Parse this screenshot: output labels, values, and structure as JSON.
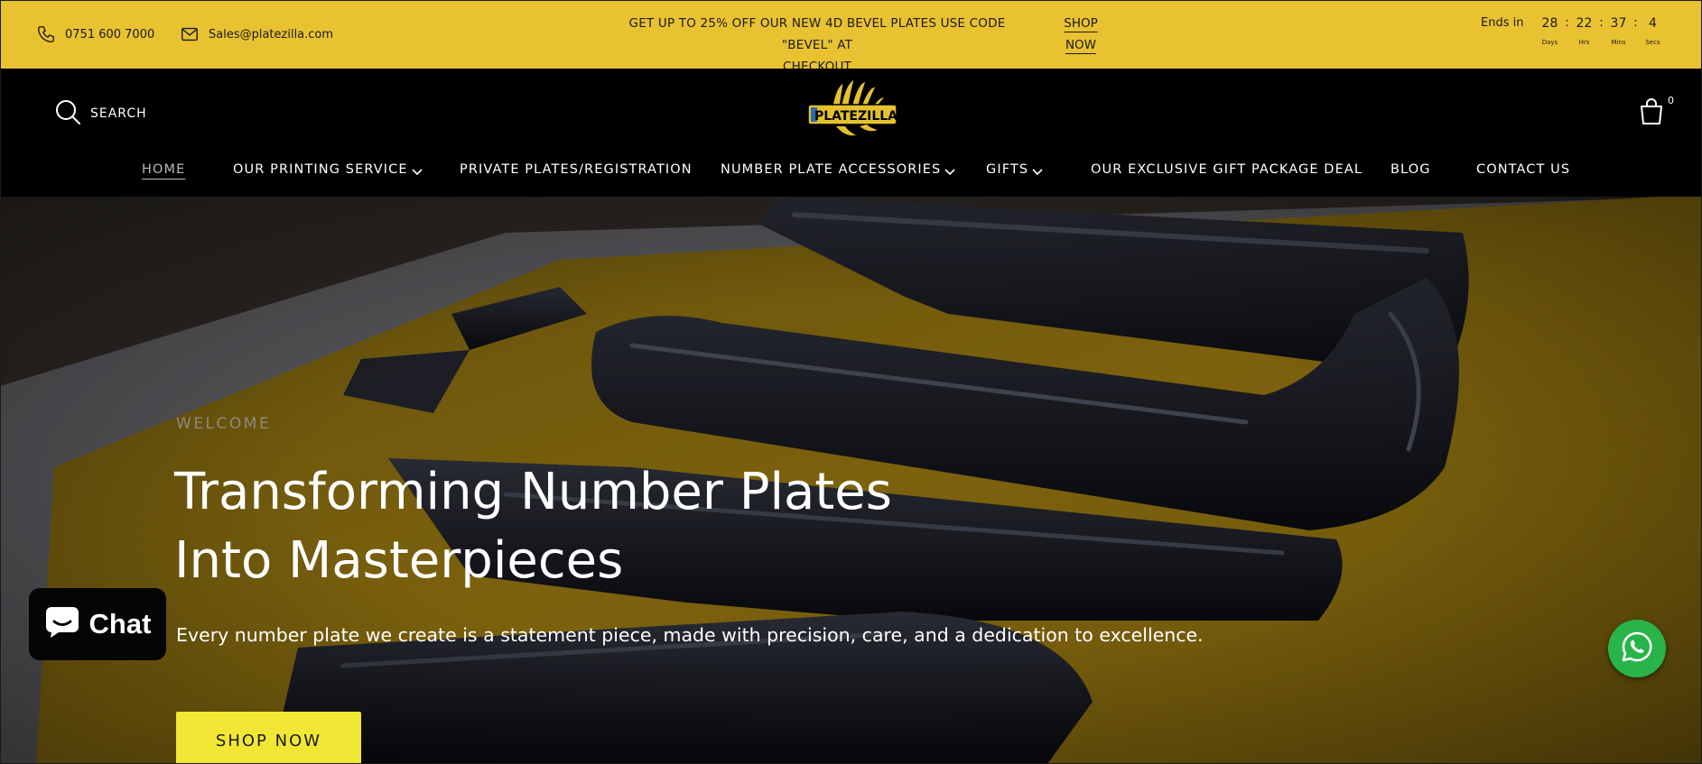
{
  "announcement": {
    "phone": "0751 600 7000",
    "email": "Sales@platezilla.com",
    "promo_line1": "GET UP TO 25% OFF OUR NEW 4D BEVEL PLATES USE CODE \"BEVEL\" AT",
    "promo_line2": "CHECKOUT",
    "shop_line1": "SHOP",
    "shop_line2": "NOW",
    "countdown": {
      "ends_label": "Ends in",
      "days": "28",
      "days_label": "Days",
      "hours": "22",
      "hours_label": "Hrs",
      "mins": "37",
      "mins_label": "Mins",
      "secs": "4",
      "secs_label": "Secs",
      "separator": ":"
    },
    "bg_color": "#e9c232"
  },
  "header": {
    "search_label": "SEARCH",
    "logo_text": "PLATEZILLA",
    "cart_count": "0",
    "icons": [
      "search-icon",
      "cart-icon",
      "phone-icon",
      "mail-icon"
    ]
  },
  "nav": [
    {
      "label": "HOME",
      "active": true
    },
    {
      "label": "OUR PRINTING SERVICE",
      "has_dropdown": true
    },
    {
      "label": "PRIVATE PLATES/REGISTRATION"
    },
    {
      "label": "NUMBER PLATE ACCESSORIES",
      "has_dropdown": true
    },
    {
      "label": "GIFTS",
      "has_dropdown": true
    },
    {
      "label": "OUR EXCLUSIVE GIFT PACKAGE DEAL"
    },
    {
      "label": "BLOG"
    },
    {
      "label": "CONTACT US"
    }
  ],
  "hero": {
    "eyebrow": "WELCOME",
    "headline_line1": "Transforming Number Plates",
    "headline_line2": "Into Masterpieces",
    "subtext": "Every number plate we create is a statement piece, made with precision, care, and a dedication to excellence.",
    "button_label": "SHOP NOW",
    "button_color": "#f2e734"
  },
  "widgets": {
    "chat_label": "Chat",
    "chat_icon": "chat-bubble-icon",
    "whatsapp_icon": "whatsapp-icon",
    "whatsapp_color": "#29b44a"
  }
}
